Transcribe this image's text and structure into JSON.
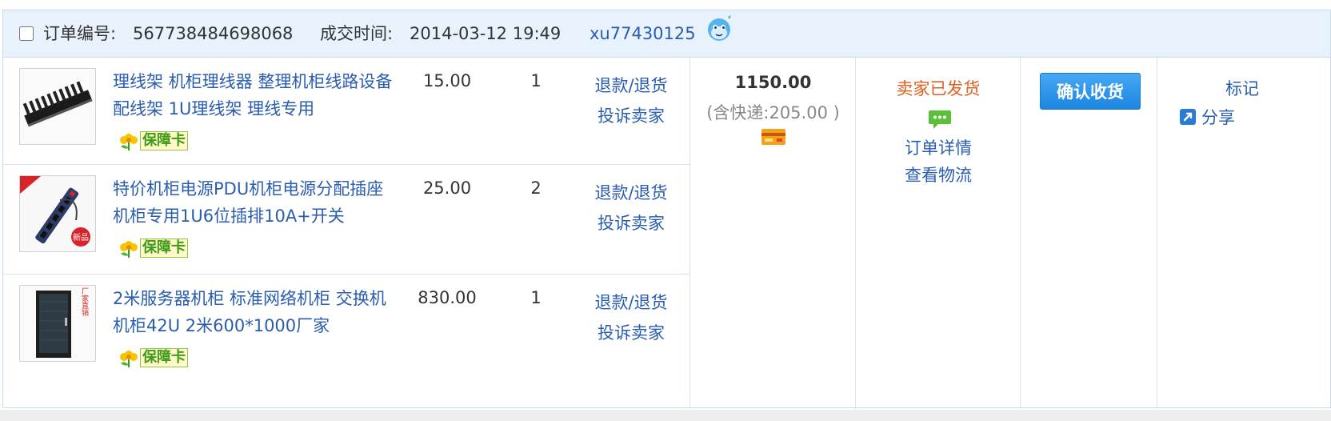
{
  "order": {
    "checked": false,
    "order_no_label": "订单编号:",
    "order_no": "567738484698068",
    "deal_time_label": "成交时间:",
    "deal_time": "2014-03-12 19:49",
    "seller": "xu77430125"
  },
  "items": [
    {
      "title": "理线架 机柜理线器 整理机柜线路设备配线架 1U理线架 理线专用",
      "badge": "保障卡",
      "price": "15.00",
      "qty": "1",
      "refund": "退款/退货",
      "complain": "投诉卖家"
    },
    {
      "title": "特价机柜电源PDU机柜电源分配插座机柜专用1U6位插排10A+开关",
      "badge": "保障卡",
      "price": "25.00",
      "qty": "2",
      "refund": "退款/退货",
      "complain": "投诉卖家",
      "thumb_label": "新品"
    },
    {
      "title": "2米服务器机柜 标准网络机柜 交换机机柜42U 2米600*1000厂家",
      "badge": "保障卡",
      "price": "830.00",
      "qty": "1",
      "refund": "退款/退货",
      "complain": "投诉卖家",
      "thumb_label": "厂家直销"
    }
  ],
  "summary": {
    "total": "1150.00",
    "shipping": "(含快递:205.00 )"
  },
  "status": {
    "text": "卖家已发货",
    "detail": "订单详情",
    "logistics": "查看物流"
  },
  "actions": {
    "confirm": "确认收货",
    "mark": "标记",
    "share": "分享"
  },
  "colors": {
    "link": "#2a5db0",
    "status": "#e06020",
    "header_bg": "#e8f2fc",
    "button": "#1d86e0"
  },
  "icons": [
    "chat-avatar-icon",
    "card-icon",
    "message-icon",
    "share-icon"
  ]
}
